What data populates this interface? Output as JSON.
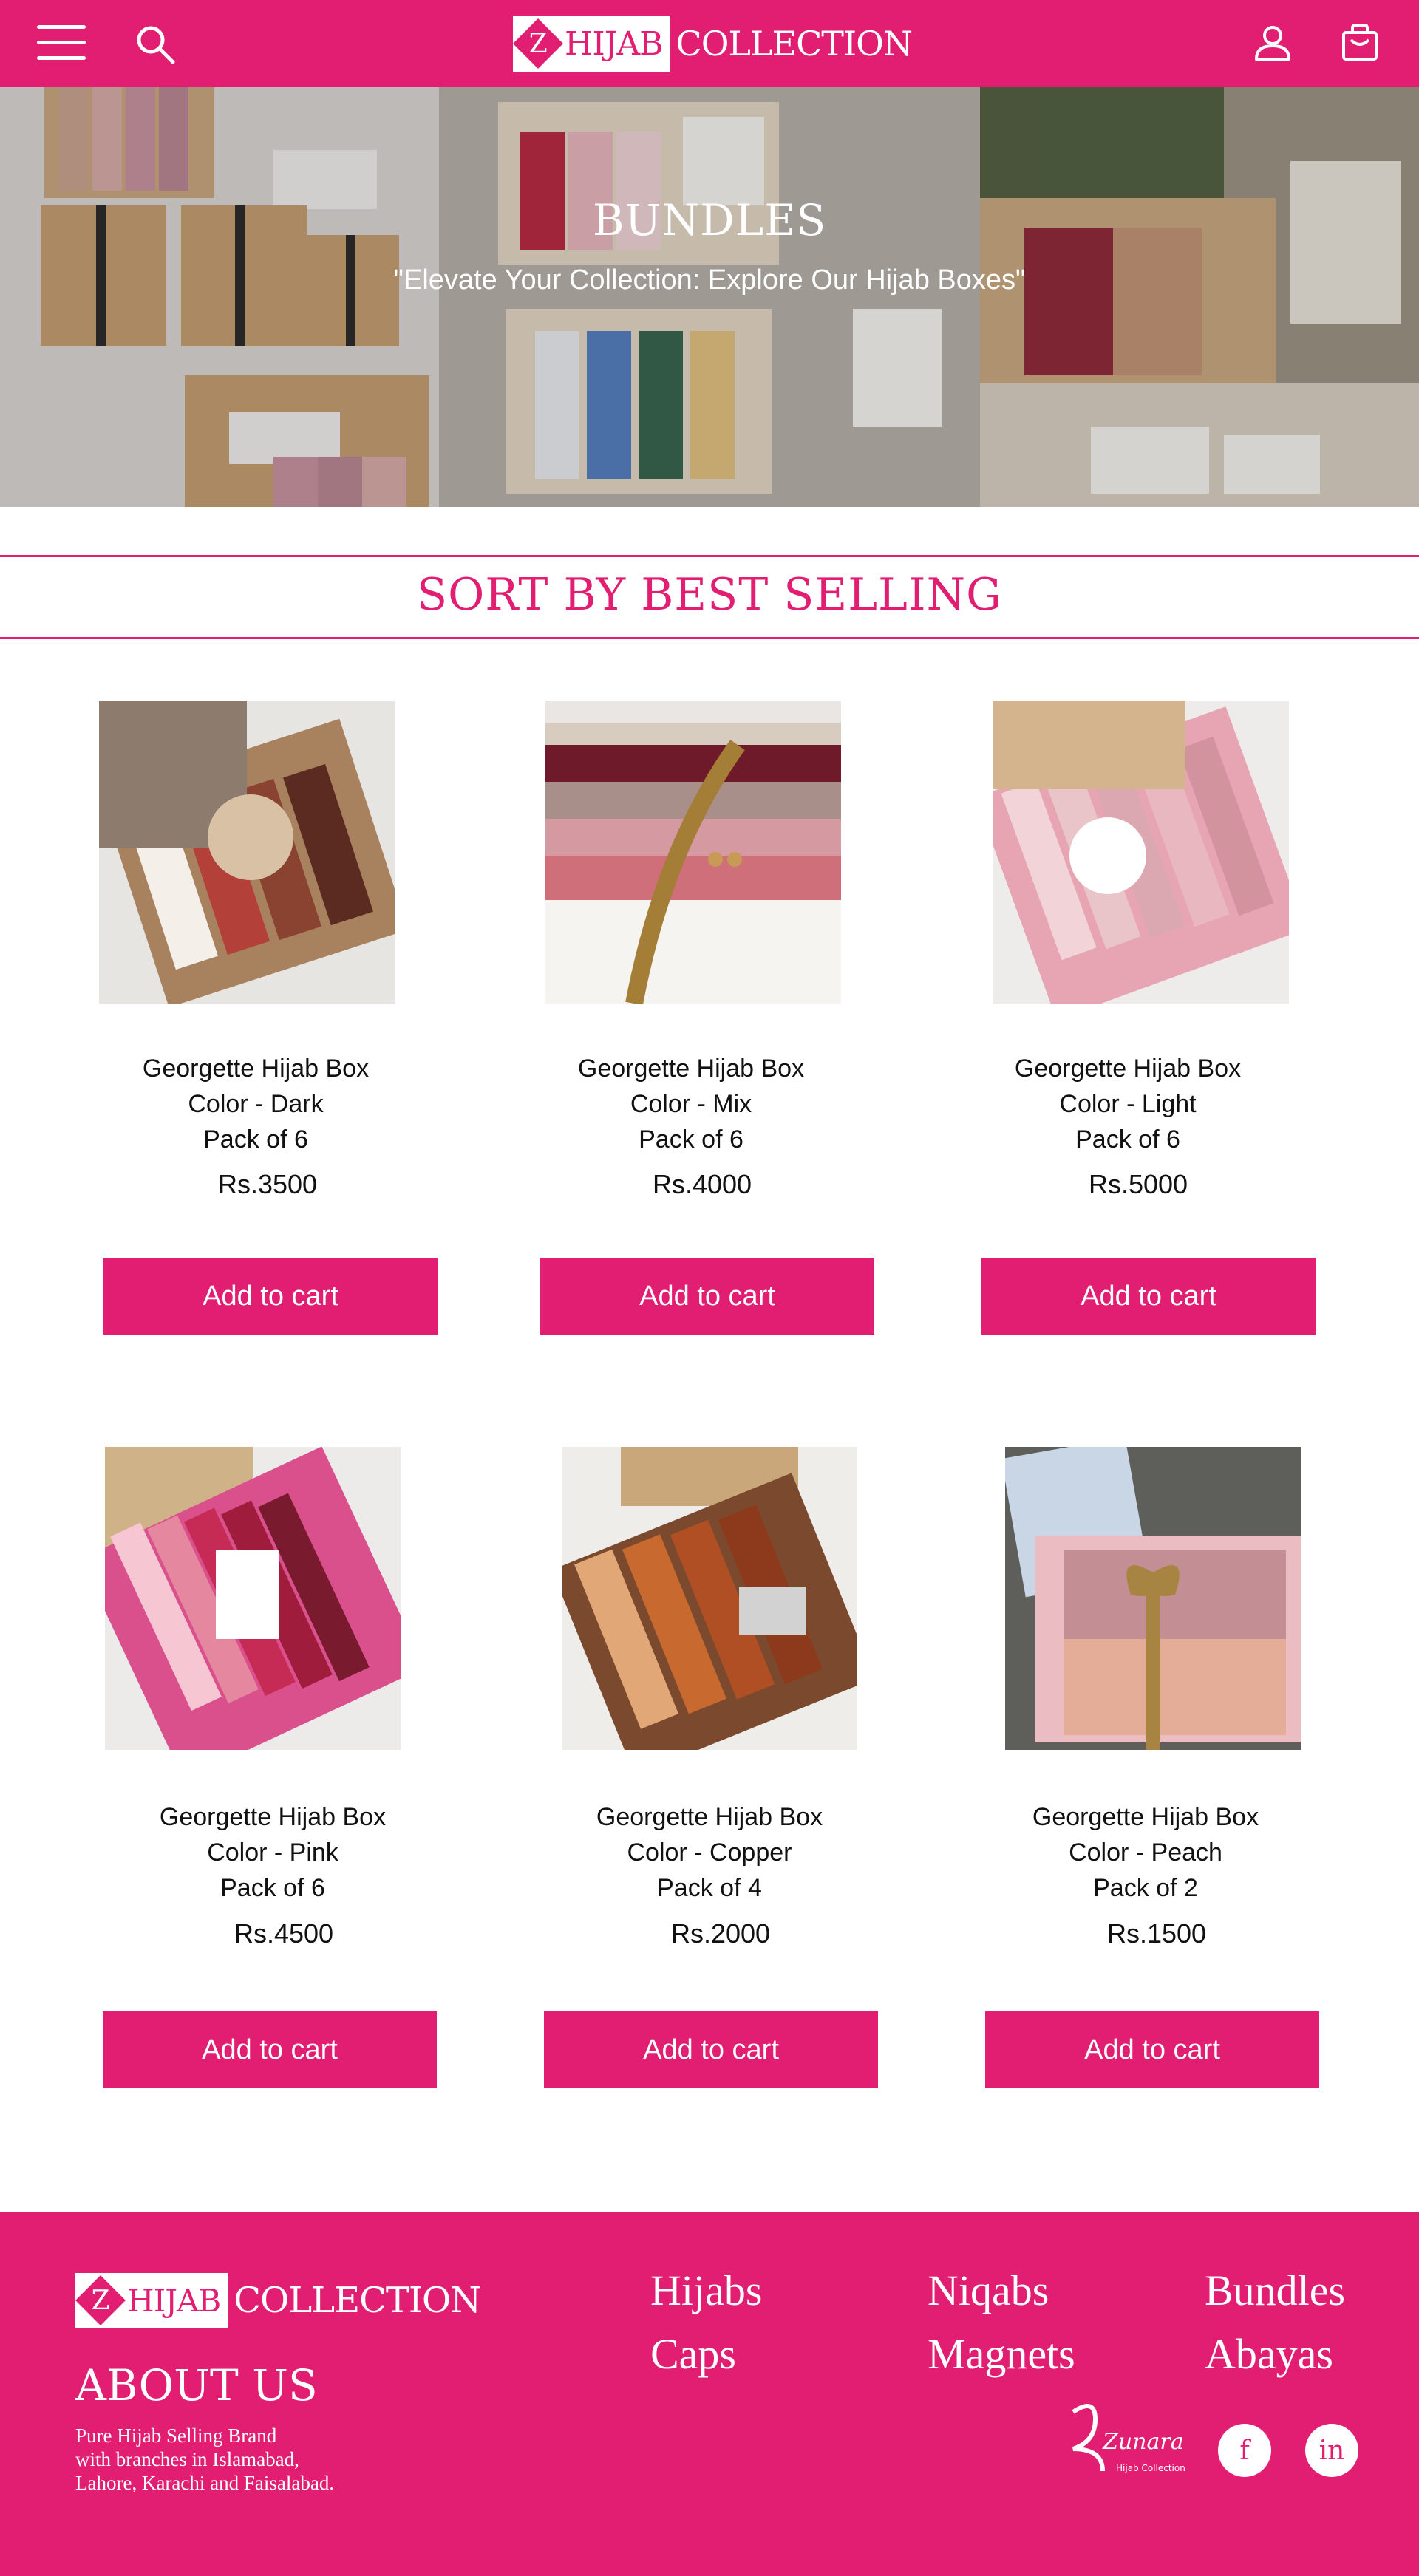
{
  "header": {
    "logo_box_text": "HIJAB",
    "logo_z": "Z",
    "logo_text": "COLLECTION"
  },
  "hero": {
    "title": "BUNDLES",
    "subtitle": "\"Elevate Your Collection: Explore Our Hijab Boxes\""
  },
  "sort_title": "SORT BY BEST SELLING",
  "products": [
    {
      "name": "Georgette Hijab Box",
      "color": "Color - Dark",
      "pack": "Pack of 6",
      "price": "Rs.3500",
      "button": "Add to cart"
    },
    {
      "name": "Georgette Hijab Box",
      "color": "Color - Mix",
      "pack": "Pack of 6",
      "price": "Rs.4000",
      "button": "Add to cart"
    },
    {
      "name": "Georgette Hijab Box",
      "color": "Color - Light",
      "pack": "Pack of 6",
      "price": "Rs.5000",
      "button": "Add to cart"
    },
    {
      "name": "Georgette Hijab Box",
      "color": "Color - Pink",
      "pack": "Pack of 6",
      "price": "Rs.4500",
      "button": "Add to cart"
    },
    {
      "name": "Georgette Hijab Box",
      "color": "Color - Copper",
      "pack": "Pack of 4",
      "price": "Rs.2000",
      "button": "Add to cart"
    },
    {
      "name": "Georgette Hijab Box",
      "color": "Color - Peach",
      "pack": "Pack of 2",
      "price": "Rs.1500",
      "button": "Add to cart"
    }
  ],
  "footer": {
    "logo_box_text": "HIJAB",
    "logo_z": "Z",
    "logo_text": "COLLECTION",
    "about_title": "ABOUT US",
    "about_lines": [
      "Pure Hijab Selling Brand",
      "with branches in Islamabad,",
      "Lahore, Karachi and Faisalabad."
    ],
    "links": [
      "Hijabs",
      "Niqabs",
      "Bundles",
      "Caps",
      "Magnets",
      "Abayas"
    ],
    "zunara_brand": "Zunara",
    "zunara_sub": "Hijab Collection",
    "social": {
      "facebook": "f",
      "linkedin": "in"
    }
  },
  "icons": {
    "menu": "hamburger-menu-icon",
    "search": "search-icon",
    "account": "user-icon",
    "cart": "shopping-bag-icon"
  },
  "colors": {
    "brand": "#e21e73",
    "background": "#ffffff",
    "text": "#111111"
  }
}
